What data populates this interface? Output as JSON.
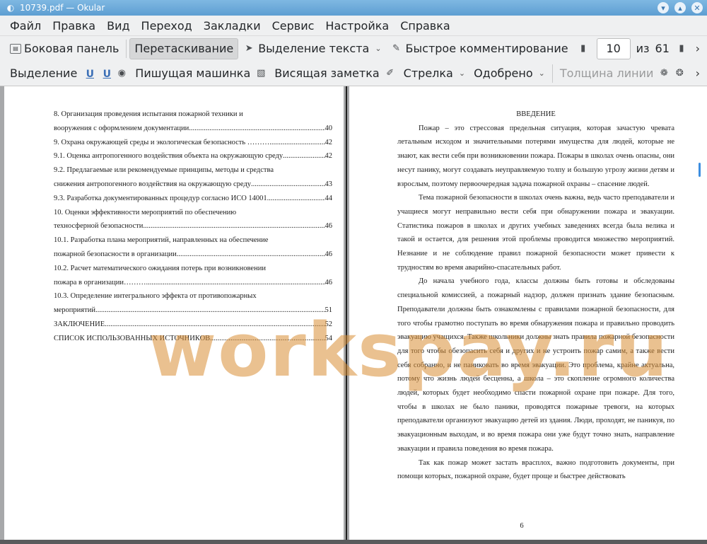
{
  "window": {
    "title": "10739.pdf  — Okular"
  },
  "menu": [
    "Файл",
    "Правка",
    "Вид",
    "Переход",
    "Закладки",
    "Сервис",
    "Настройка",
    "Справка"
  ],
  "toolbar1": {
    "sidebar": "Боковая панель",
    "drag": "Перетаскивание",
    "text_select": "Выделение текста",
    "quick_annotate": "Быстрое комментирование",
    "page_current": "10",
    "page_of": "из",
    "page_total": "61"
  },
  "toolbar2": {
    "highlight": "Выделение",
    "typewriter": "Пишущая машинка",
    "note": "Висящая заметка",
    "arrow": "Стрелка",
    "stamp": "Одобрено",
    "line_width": "Толщина линии"
  },
  "toc": [
    {
      "text": "8. Организация проведения испытания пожарной техники и",
      "page": ""
    },
    {
      "text": "вооружения с оформлением документации",
      "page": "40",
      "dots": true
    },
    {
      "text": "9. Охрана окружающей среды и экологическая безопасность ……….",
      "page": "42",
      "dots": true
    },
    {
      "text": "9.1. Оценка антропогенного воздействия объекта на окружающую среду",
      "page": "42",
      "dots": true
    },
    {
      "text": "9.2. Предлагаемые или рекомендуемые принципы, методы и средства",
      "page": ""
    },
    {
      "text": "снижения антропогенного воздействия на окружающую среду",
      "page": "43",
      "dots": true
    },
    {
      "text": "9.3. Разработка документированных процедур согласно ИСО 14001",
      "page": "44",
      "dots": true
    },
    {
      "text": "10. Оценки эффективности мероприятий по обеспечению",
      "page": ""
    },
    {
      "text": "техносферной безопасности",
      "page": "46",
      "dots": true
    },
    {
      "text": "10.1. Разработка плана мероприятий, направленных на обеспечение",
      "page": ""
    },
    {
      "text": " пожарной безопасности в организации",
      "page": "46",
      "dots": true
    },
    {
      "text": "10.2. Расчет математического ожидания потерь при возникновении",
      "page": ""
    },
    {
      "text": "пожара в организации………",
      "page": "46",
      "dots": true
    },
    {
      "text": "10.3. Определение интегрального эффекта от противопожарных",
      "page": ""
    },
    {
      "text": "мероприятий",
      "page": "51",
      "dots": true
    },
    {
      "text": "ЗАКЛЮЧЕНИЕ",
      "page": "52",
      "dots": true
    },
    {
      "text": "СПИСОК ИСПОЛЬЗОВАННЫХ ИСТОЧНИКОВ",
      "page": "54",
      "dots": true
    }
  ],
  "right_page": {
    "title": "ВВЕДЕНИЕ",
    "paragraphs": [
      "Пожар – это стрессовая предельная ситуация, которая зачастую чревата летальным исходом и значительными потерями имущества для людей, которые не знают, как вести себя при возникновении пожара. Пожары в школах очень опасны, они несут панику, могут создавать неуправляемую толпу и большую угрозу жизни детям и взрослым, поэтому первоочередная задача пожарной охраны – спасение людей.",
      "Тема пожарной безопасности в школах очень важна, ведь часто преподаватели и учащиеся могут неправильно вести себя при обнаружении пожара и эвакуации. Статистика пожаров в школах и других учебных заведениях всегда была велика и такой и остается, для решения этой проблемы проводится множество мероприятий. Незнание и не соблюдение правил пожарной безопасности может привести к трудностям во время аварийно-спасательных работ.",
      "До начала учебного года, классы должны быть готовы и обследованы специальной комиссией, а пожарный надзор, должен признать здание безопасным. Преподаватели должны быть ознакомлены с правилами пожарной безопасности, для того чтобы грамотно поступать во время обнаружения пожара и правильно проводить эвакуацию учащихся. Также школьники должны знать правила пожарной безопасности для того чтобы обезопасить себя и других и не устроить пожар самим, а также вести себя собранно, и не паниковать во время эвакуации. Это проблема, крайне актуальна, потому что жизнь людей бесценна, а школа – это скопление огромного количества людей, которых будет необходимо спасти пожарной охране при пожаре. Для того, чтобы в школах не было паники, проводятся пожарные тревоги, на которых преподаватели организуют эвакуацию детей из здания. Люди, проходят, не паникуя, по эвакуационным выходам, и во время пожара они уже будут точно знать, направление эвакуации и правила поведения во время пожара.",
      "Так как пожар может застать врасплох, важно подготовить документы, при помощи которых, пожарной охране, будет проще и быстрее действовать"
    ],
    "page_number": "6"
  },
  "watermark": "workspay.ru",
  "icons": {
    "app": "okular-icon",
    "sidebar": "sidebar-icon",
    "text_select": "cursor-icon",
    "quick_annotate": "pen-icon"
  }
}
